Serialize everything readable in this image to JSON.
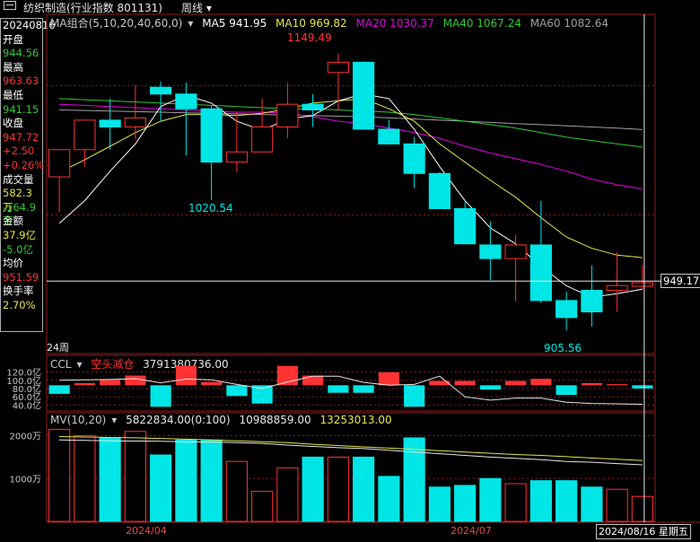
{
  "header": {
    "title": "纺织制造(行业指数 801131)",
    "period": "周线"
  },
  "side_panel": {
    "date": "20240816",
    "open_label": "开盘",
    "open": "944.56",
    "high_label": "最高",
    "high": "963.63",
    "low_label": "最低",
    "low": "941.15",
    "close_label": "收盘",
    "close": "947.72",
    "change": "+2.50",
    "change_pct": "+0.26%",
    "volume_label": "成交量",
    "volume": "582.3万",
    "volume_change": "-164.9万",
    "amount_label": "金额",
    "amount": "37.9亿",
    "amount_change": "-5.0亿",
    "avg_label": "均价",
    "avg": "951.59",
    "turnover_label": "换手率",
    "turnover": "2.70%"
  },
  "ma_legend": {
    "title": "MA组合(5,10,20,40,60,0)",
    "ma5": "MA5 941.95",
    "ma10": "MA10 969.82",
    "ma20": "MA20 1030.37",
    "ma40": "MA40 1067.24",
    "ma60": "MA60 1082.64"
  },
  "ccl_legend": {
    "name": "CCL",
    "state": "空头减仓",
    "value": "3791380736.00"
  },
  "mv_legend": {
    "name": "MV(10,20)",
    "v1": "5822834.00(0:100)",
    "v2": "10988859.00",
    "v3": "13253013.00"
  },
  "annotations": {
    "high": "1149.49",
    "low1": "1020.54",
    "low2": "905.56",
    "current_price": "949.17",
    "weeks": "24周",
    "cursor_date": "2024/08/16 星期五"
  },
  "colors": {
    "up": "#ff3232",
    "down": "#00e6e6",
    "ma5": "#ffffff",
    "ma10": "#e6e64b",
    "ma20": "#e600e6",
    "ma40": "#32c832",
    "ma60": "#a0a0a0",
    "grid": "#8c1e1e"
  },
  "chart_data": [
    {
      "type": "candlestick",
      "title": "",
      "x": [
        "2024-03-08",
        "2024-03-15",
        "2024-03-22",
        "2024-03-29",
        "2024-04-03",
        "2024-04-12",
        "2024-04-19",
        "2024-04-26",
        "2024-04-30",
        "2024-05-10",
        "2024-05-17",
        "2024-05-24",
        "2024-05-31",
        "2024-06-07",
        "2024-06-14",
        "2024-06-21",
        "2024-06-28",
        "2024-07-05",
        "2024-07-12",
        "2024-07-19",
        "2024-07-26",
        "2024-08-02",
        "2024-08-09",
        "2024-08-16"
      ],
      "open": [
        1041,
        1065,
        1091,
        1085,
        1120,
        1114,
        1101,
        1054,
        1063,
        1085,
        1105,
        1133,
        1142,
        1083,
        1070,
        1044,
        1013,
        981,
        969,
        981,
        932,
        941,
        941,
        944.56
      ],
      "high": [
        1050,
        1090,
        1110,
        1122,
        1125,
        1124,
        1104,
        1098,
        1110,
        1124,
        1114,
        1149.49,
        1143,
        1091,
        1076,
        1045,
        1019,
        1002,
        990,
        1020,
        940,
        963,
        975,
        963.63
      ],
      "low": [
        1010,
        1050,
        1065,
        1074,
        1090,
        1060,
        1020.54,
        1045,
        1063,
        1075,
        1085,
        1100,
        1105,
        1081,
        1031,
        1029,
        984,
        950,
        931,
        930,
        905.56,
        909,
        922,
        941.15
      ],
      "close": [
        1065,
        1091,
        1085,
        1093,
        1114,
        1101,
        1054,
        1063,
        1085,
        1105,
        1100,
        1142,
        1083,
        1070,
        1044,
        1013,
        982,
        969,
        981,
        932,
        917,
        922,
        945.22,
        947.72
      ],
      "ma5": [
        1000,
        1020,
        1046,
        1070,
        1103,
        1113,
        1106,
        1090,
        1082,
        1092,
        1095,
        1108,
        1114,
        1110,
        1083,
        1050,
        1020,
        996,
        982,
        962,
        945,
        935,
        938,
        941.95
      ],
      "ma10": [
        1045,
        1056,
        1068,
        1080,
        1090,
        1096,
        1096,
        1095,
        1097,
        1101,
        1106,
        1108,
        1110,
        1101,
        1090,
        1070,
        1054,
        1038,
        1023,
        1005,
        988,
        978,
        972,
        969.82
      ],
      "ma20": [
        1105,
        1104,
        1103,
        1102,
        1101,
        1100,
        1099,
        1098,
        1098,
        1097,
        1094,
        1090,
        1088,
        1084,
        1080,
        1075,
        1068,
        1062,
        1057,
        1052,
        1046,
        1039,
        1034,
        1030.37
      ],
      "ma40": [
        1110,
        1109,
        1108,
        1107,
        1106,
        1105,
        1104,
        1103,
        1102,
        1101,
        1101,
        1100,
        1099,
        1098,
        1096,
        1093,
        1090,
        1087,
        1084,
        1080,
        1076,
        1073,
        1070,
        1067.24
      ],
      "ma60": [
        1100,
        1099.5,
        1099,
        1098.5,
        1098,
        1097.5,
        1097,
        1096.5,
        1096,
        1095.5,
        1095,
        1094.5,
        1094,
        1093,
        1092,
        1091,
        1090,
        1089,
        1088,
        1087,
        1086,
        1085,
        1084,
        1082.64
      ],
      "current_price": 949.17,
      "ylim": [
        890,
        1170
      ]
    },
    {
      "type": "bar",
      "title": "",
      "values": [
        -0.4,
        0.1,
        0.25,
        0.45,
        -1.0,
        0.9,
        0.15,
        -0.5,
        -0.85,
        0.9,
        0.45,
        -0.35,
        -0.35,
        0.6,
        -1.0,
        0.2,
        0.2,
        -0.2,
        0.2,
        0.3,
        -0.45,
        0.1,
        0.05,
        -0.15
      ],
      "line": [
        100,
        101,
        102,
        104,
        94,
        103,
        101,
        90,
        80,
        96,
        110,
        110,
        95,
        88,
        90,
        110,
        60,
        52,
        57,
        57,
        47,
        44,
        43,
        42
      ],
      "yticks": [
        120,
        100,
        80,
        60,
        40
      ],
      "ytick_labels": [
        "120.0亿",
        "100.0亿",
        "80.0亿",
        "60.0亿",
        "40.0亿"
      ],
      "ylim": [
        30,
        130
      ]
    },
    {
      "type": "bar",
      "title": "",
      "values": [
        2150,
        2000,
        1950,
        2100,
        1550,
        1900,
        1900,
        1400,
        700,
        1250,
        1500,
        1500,
        1500,
        1050,
        1950,
        800,
        840,
        1000,
        880,
        950,
        950,
        800,
        750,
        582.3
      ],
      "mv10": [
        1900,
        1890,
        1880,
        1875,
        1870,
        1860,
        1850,
        1840,
        1820,
        1780,
        1750,
        1720,
        1700,
        1660,
        1620,
        1580,
        1540,
        1500,
        1470,
        1440,
        1400,
        1380,
        1350,
        1320
      ],
      "mv20": [
        1980,
        1970,
        1960,
        1950,
        1935,
        1920,
        1900,
        1880,
        1860,
        1840,
        1800,
        1770,
        1740,
        1710,
        1680,
        1650,
        1620,
        1590,
        1560,
        1540,
        1510,
        1480,
        1450,
        1420
      ],
      "yticks": [
        2000,
        1000
      ],
      "ytick_labels": [
        "2000万",
        "1000万"
      ],
      "ylim": [
        0,
        2200
      ]
    }
  ],
  "x_axis_labels": [
    "2024/04",
    "2024/07"
  ]
}
